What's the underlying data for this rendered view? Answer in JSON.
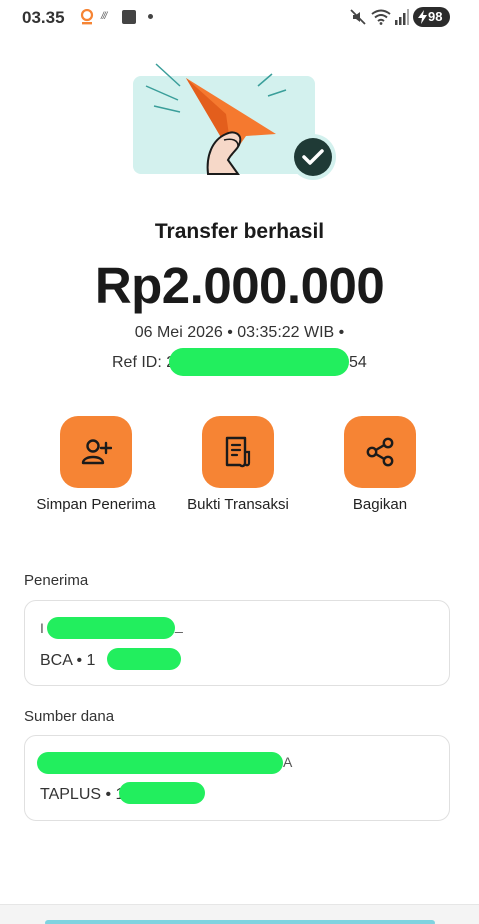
{
  "status_bar": {
    "time": "03.35",
    "battery": "98"
  },
  "receipt": {
    "title": "Transfer berhasil",
    "amount": "Rp2.000.000",
    "datetime": "06 Mei 2026 • 03:35:22 WIB •",
    "ref_label": "Ref ID: 2",
    "ref_tail": "54"
  },
  "actions": [
    {
      "label": "Simpan Penerima",
      "icon": "add-person-icon"
    },
    {
      "label": "Bukti Transaksi",
      "icon": "document-icon"
    },
    {
      "label": "Bagikan",
      "icon": "share-icon"
    }
  ],
  "recipient": {
    "section_label": "Penerima",
    "name_prefix": "I",
    "name_suffix": "_",
    "bank_prefix": "BCA • 1"
  },
  "source": {
    "section_label": "Sumber dana",
    "name_suffix": "A",
    "account_prefix": "TAPLUS • 1"
  },
  "colors": {
    "accent": "#f68434",
    "redaction": "#22ee5e",
    "teal_bg": "#d3f1ee",
    "success_badge": "#1f3a36"
  }
}
